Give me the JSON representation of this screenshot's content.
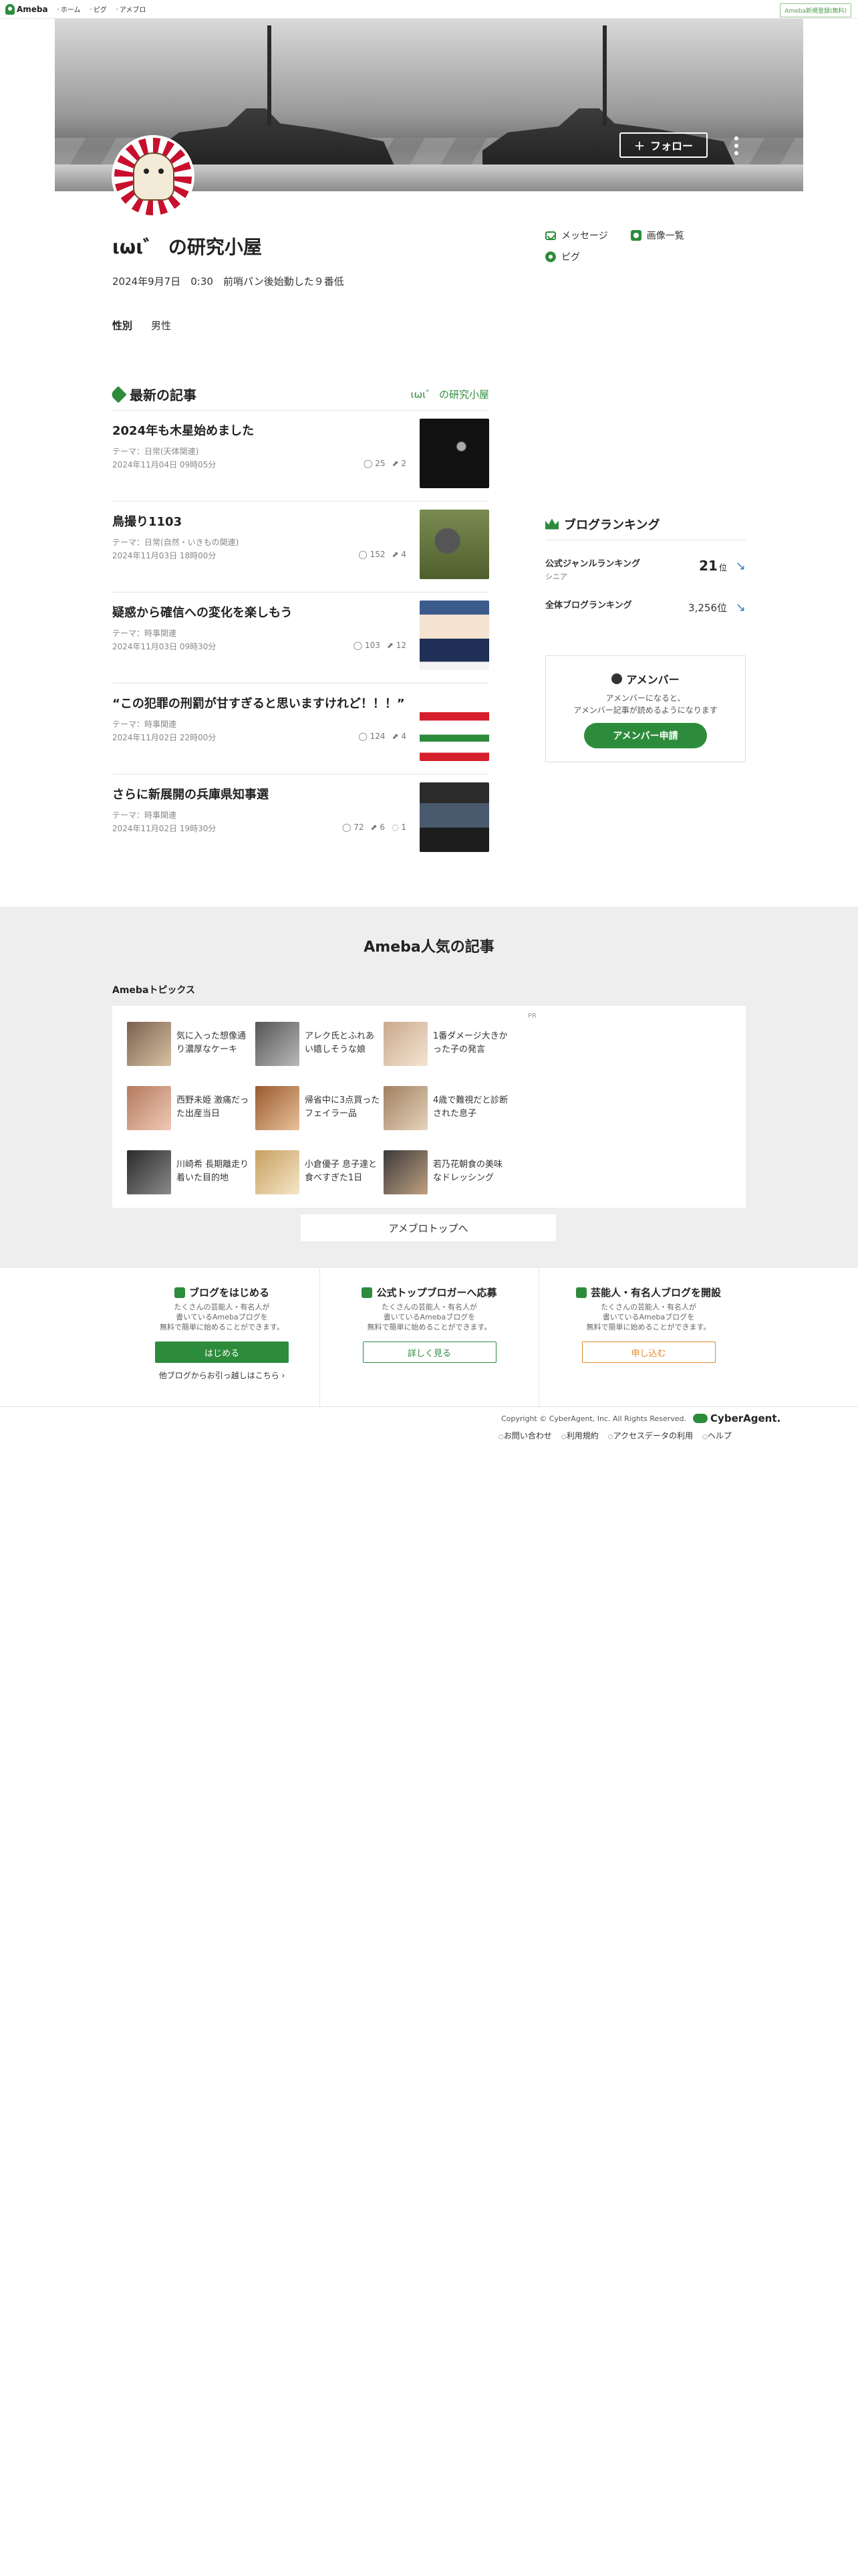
{
  "nav": {
    "logo": "Ameba",
    "links": [
      "ホーム",
      "ピグ",
      "アメブロ"
    ],
    "register": "Ameba新規登録(無料)"
  },
  "header": {
    "follow": "フォロー"
  },
  "profile": {
    "title": "ιωι゛ の研究小屋",
    "description": "2024年9月7日　0:30　前哨パン後始動した９番低",
    "gender_label": "性別",
    "gender_value": "男性"
  },
  "side_links": {
    "message": "メッセージ",
    "images": "画像一覧",
    "pigg": "ピグ"
  },
  "latest": {
    "heading": "最新の記事",
    "blog_link": "ιωι゛ の研究小屋",
    "articles": [
      {
        "title": "2024年も木星始めました",
        "theme": "テーマ：日常(天体関連)",
        "date": "2024年11月04日 09時05分",
        "views": "25",
        "likes": "2",
        "comments": ""
      },
      {
        "title": "鳥撮り1103",
        "theme": "テーマ：日常(自然・いきもの関連)",
        "date": "2024年11月03日 18時00分",
        "views": "152",
        "likes": "4",
        "comments": ""
      },
      {
        "title": "疑惑から確信への変化を楽しもう",
        "theme": "テーマ：時事関連",
        "date": "2024年11月03日 09時30分",
        "views": "103",
        "likes": "12",
        "comments": ""
      },
      {
        "title": "“この犯罪の刑罰が甘すぎると思いますけれど！！！”",
        "theme": "テーマ：時事関連",
        "date": "2024年11月02日 22時00分",
        "views": "124",
        "likes": "4",
        "comments": ""
      },
      {
        "title": "さらに新展開の兵庫県知事選",
        "theme": "テーマ：時事関連",
        "date": "2024年11月02日 19時30分",
        "views": "72",
        "likes": "6",
        "comments": "1"
      }
    ]
  },
  "ranking": {
    "heading": "ブログランキング",
    "genre_label": "公式ジャンルランキング",
    "genre_sub": "シニア",
    "genre_value": "21",
    "genre_unit": "位",
    "all_label": "全体ブログランキング",
    "all_value": "3,256位"
  },
  "amember": {
    "heading": "アメンバー",
    "desc1": "アメンバーになると、",
    "desc2": "アメンバー記事が読めるようになります",
    "button": "アメンバー申請"
  },
  "popular": {
    "heading": "Ameba人気の記事",
    "sub": "Amebaトピックス",
    "pr": "PR",
    "topics": [
      "気に入った想像通り濃厚なケーキ",
      "アレク氏とふれあい嬉しそうな娘",
      "1番ダメージ大きかった子の発言",
      "西野未姫 激痛だった出産当日",
      "帰省中に3点買ったフェイラー品",
      "4歳で難視だと診断された息子",
      "川崎希 長期離走り着いた目的地",
      "小倉優子 息子達と食べすぎた1日",
      "若乃花朝食の美味なドレッシング"
    ],
    "top_button": "アメブロトップへ"
  },
  "promos": [
    {
      "heading": "ブログをはじめる",
      "desc1": "たくさんの芸能人・有名人が",
      "desc2": "書いているAmebaブログを",
      "desc3": "無料で簡単に始めることができます。",
      "button": "はじめる",
      "extra": "他ブログからお引っ越しはこちら ›"
    },
    {
      "heading": "公式トップブロガーへ応募",
      "desc1": "たくさんの芸能人・有名人が",
      "desc2": "書いているAmebaブログを",
      "desc3": "無料で簡単に始めることができます。",
      "button": "詳しく見る",
      "extra": ""
    },
    {
      "heading": "芸能人・有名人ブログを開設",
      "desc1": "たくさんの芸能人・有名人が",
      "desc2": "書いているAmebaブログを",
      "desc3": "無料で簡単に始めることができます。",
      "button": "申し込む",
      "extra": ""
    }
  ],
  "footer": {
    "copyright": "Copyright © CyberAgent, Inc. All Rights Reserved.",
    "brand": "CyberAgent.",
    "links": [
      "お問い合わせ",
      "利用規約",
      "アクセスデータの利用",
      "ヘルプ"
    ]
  },
  "colors": {
    "accent": "#2d8c3c",
    "link_blue": "#2a7fd4",
    "promo_orange": "#e28a2b"
  }
}
